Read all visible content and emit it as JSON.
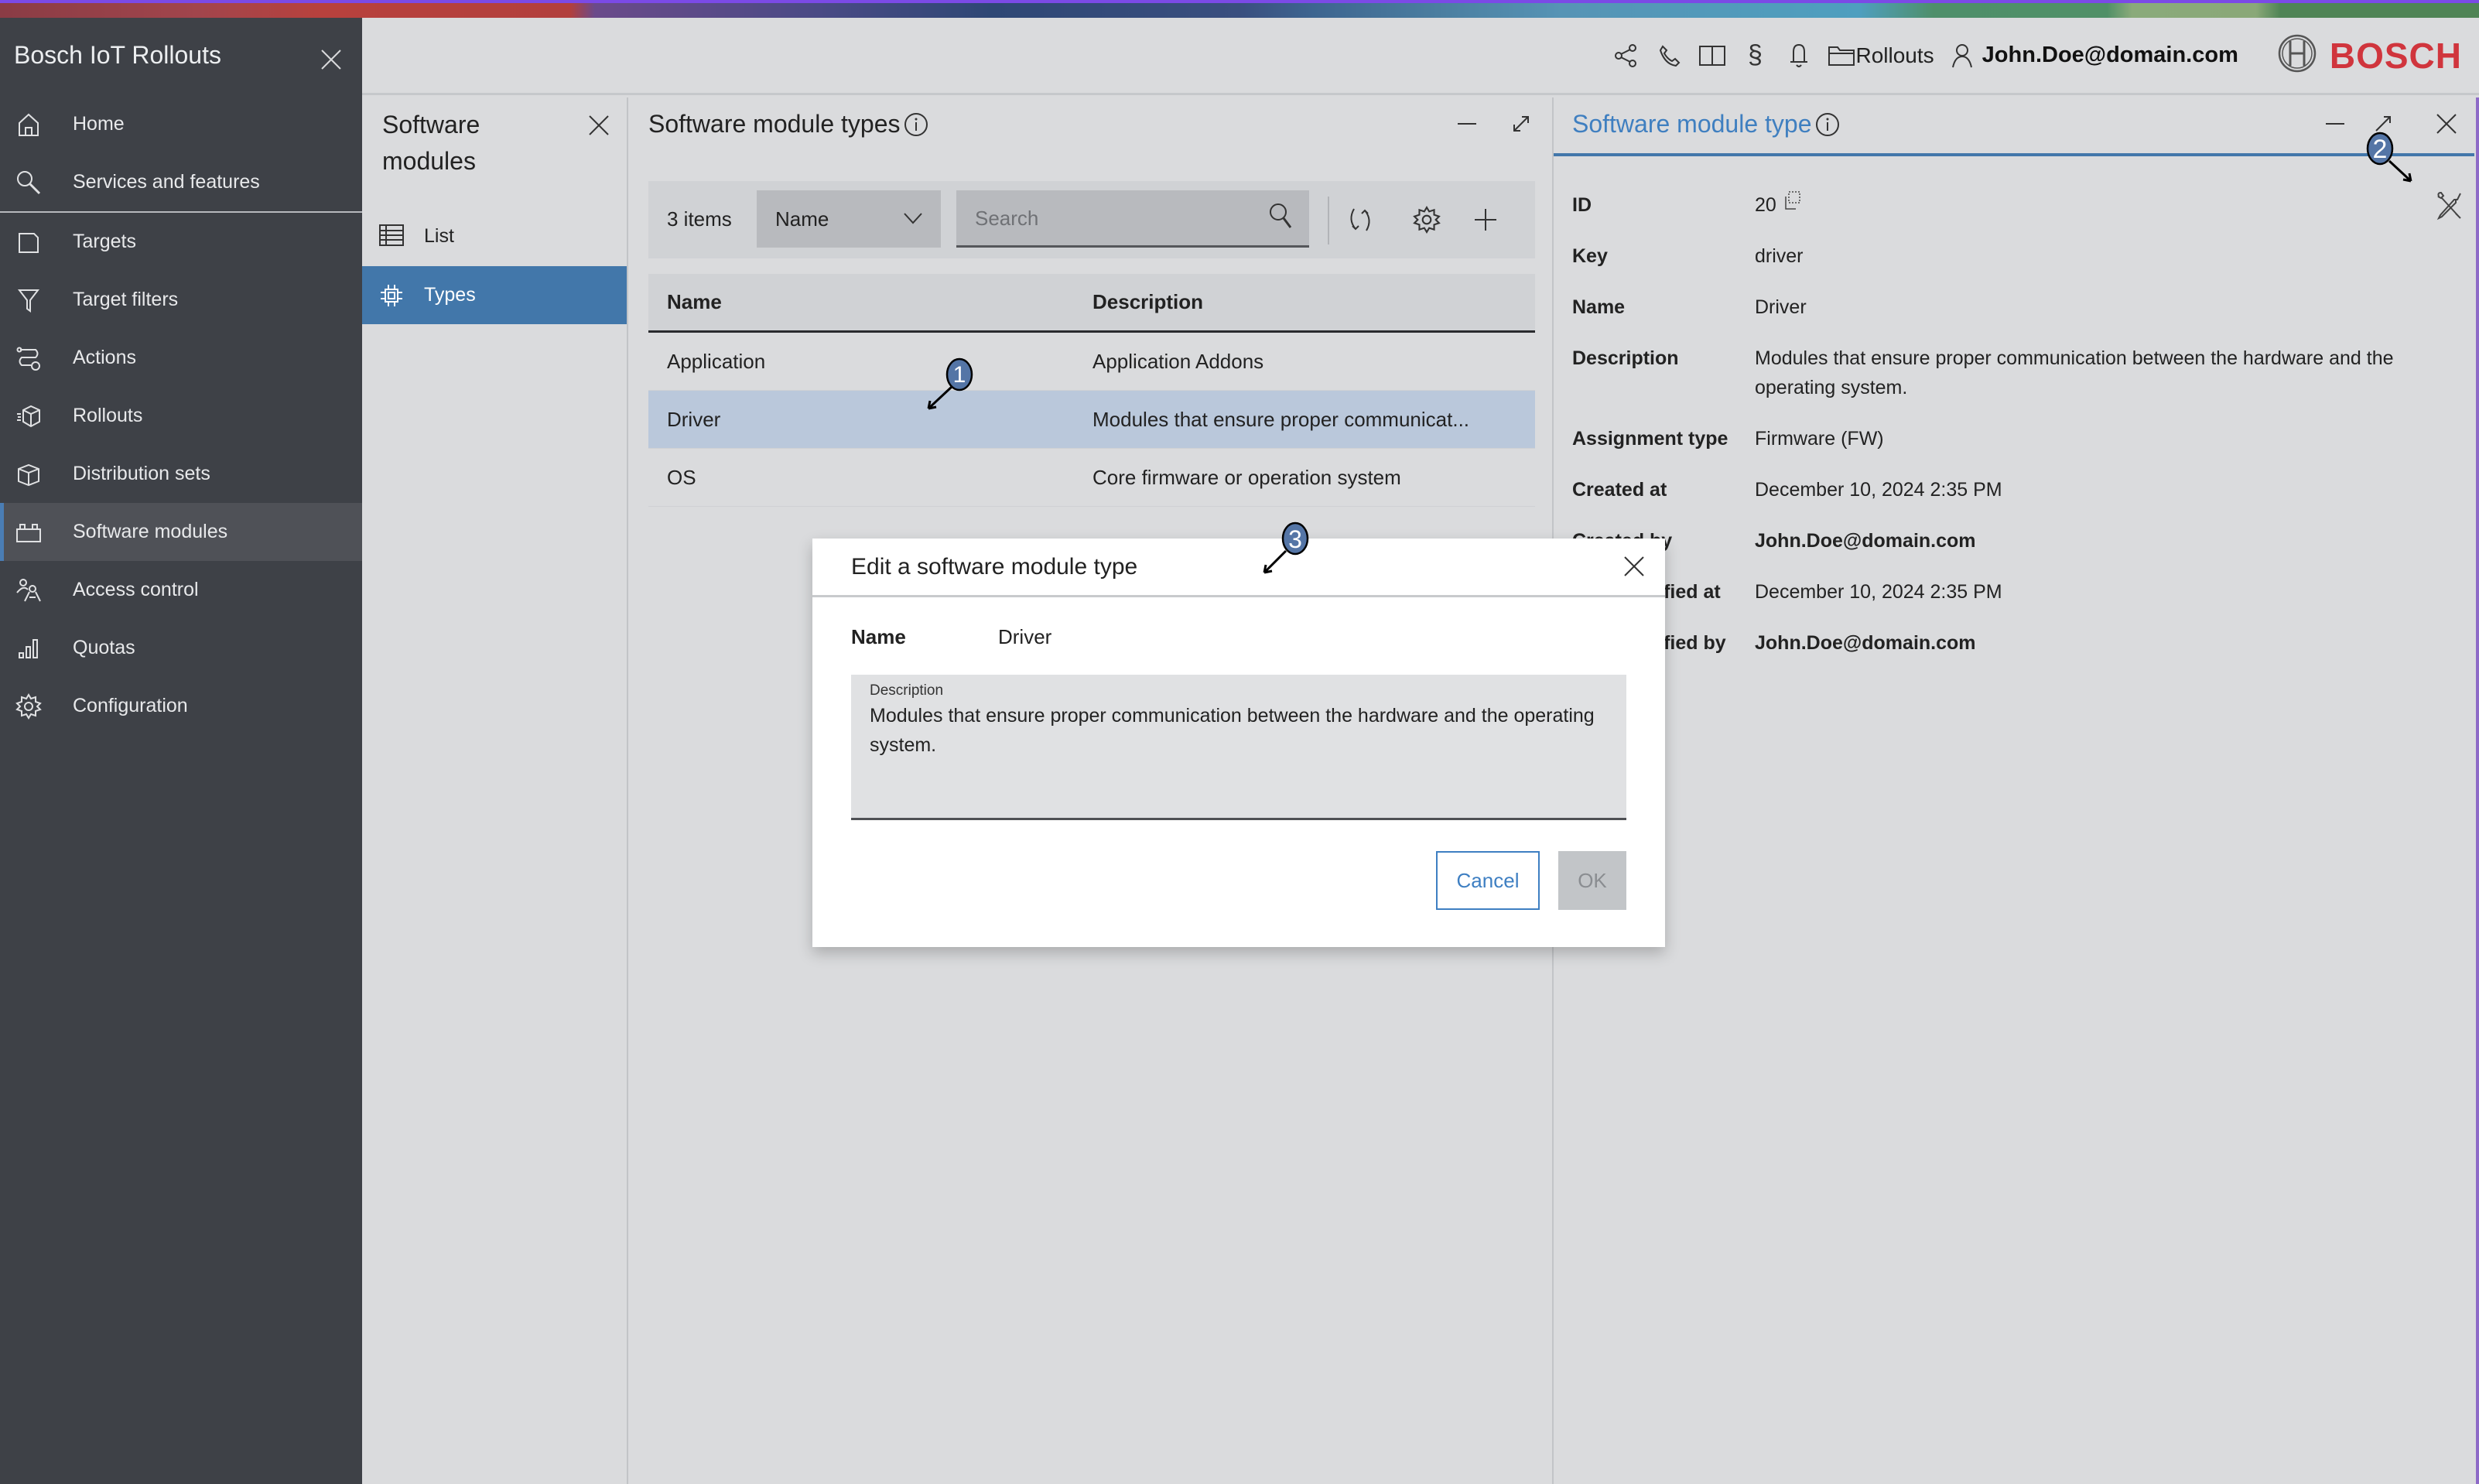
{
  "app": {
    "title": "Bosch IoT Rollouts",
    "brand_logo_text": "BOSCH",
    "colors": {
      "sidebar_bg": "#3e4147",
      "accent_blue": "#4277aa",
      "link_blue": "#3f7fc0",
      "selected_row": "#bac8db",
      "brand_red": "#d0353d"
    }
  },
  "sidebar": {
    "items": [
      {
        "label": "Home",
        "icon": "home-icon"
      },
      {
        "label": "Services and features",
        "icon": "search-icon"
      },
      {
        "label": "Targets",
        "icon": "target-device-icon"
      },
      {
        "label": "Target filters",
        "icon": "filter-icon"
      },
      {
        "label": "Actions",
        "icon": "actions-icon"
      },
      {
        "label": "Rollouts",
        "icon": "rollout-box-icon"
      },
      {
        "label": "Distribution sets",
        "icon": "box-icon"
      },
      {
        "label": "Software modules",
        "icon": "module-brick-icon",
        "active": true
      },
      {
        "label": "Access control",
        "icon": "users-keys-icon"
      },
      {
        "label": "Quotas",
        "icon": "bar-chart-icon"
      },
      {
        "label": "Configuration",
        "icon": "gear-icon"
      }
    ]
  },
  "header": {
    "icons": [
      "share-icon",
      "phone-icon",
      "book-icon",
      "legal-paragraph-icon",
      "bell-icon"
    ],
    "context_label": "Rollouts",
    "user": "John.Doe@domain.com"
  },
  "submenu": {
    "title": "Software modules",
    "items": [
      {
        "label": "List",
        "icon": "table-icon"
      },
      {
        "label": "Types",
        "icon": "chip-icon",
        "active": true
      }
    ]
  },
  "types_panel": {
    "title": "Software module types",
    "item_count": "3 items",
    "sort_select": "Name",
    "search_placeholder": "Search",
    "columns": [
      "Name",
      "Description"
    ],
    "rows": [
      {
        "name": "Application",
        "description": "Application Addons"
      },
      {
        "name": "Driver",
        "description": "Modules that ensure proper communicat...",
        "selected": true
      },
      {
        "name": "OS",
        "description": "Core firmware or operation system"
      }
    ]
  },
  "detail_panel": {
    "title": "Software module type",
    "fields": [
      {
        "label": "ID",
        "value": "20"
      },
      {
        "label": "Key",
        "value": "driver"
      },
      {
        "label": "Name",
        "value": "Driver"
      },
      {
        "label": "Description",
        "value": "Modules that ensure proper communication between the hardware and the operating system."
      },
      {
        "label": "Assignment type",
        "value": "Firmware (FW)"
      },
      {
        "label": "Created at",
        "value": "December 10, 2024 2:35 PM"
      },
      {
        "label": "Created by",
        "value": "John.Doe@domain.com"
      },
      {
        "label": "Last modified at",
        "value": "December 10, 2024 2:35 PM"
      },
      {
        "label": "Last modified by",
        "value": "John.Doe@domain.com"
      }
    ]
  },
  "modal": {
    "title": "Edit a software module type",
    "name_label": "Name",
    "name_value": "Driver",
    "description_label": "Description",
    "description_value": "Modules that ensure proper communication between the hardware and the operating system.",
    "cancel_label": "Cancel",
    "ok_label": "OK"
  },
  "callouts": [
    "1",
    "2",
    "3"
  ]
}
